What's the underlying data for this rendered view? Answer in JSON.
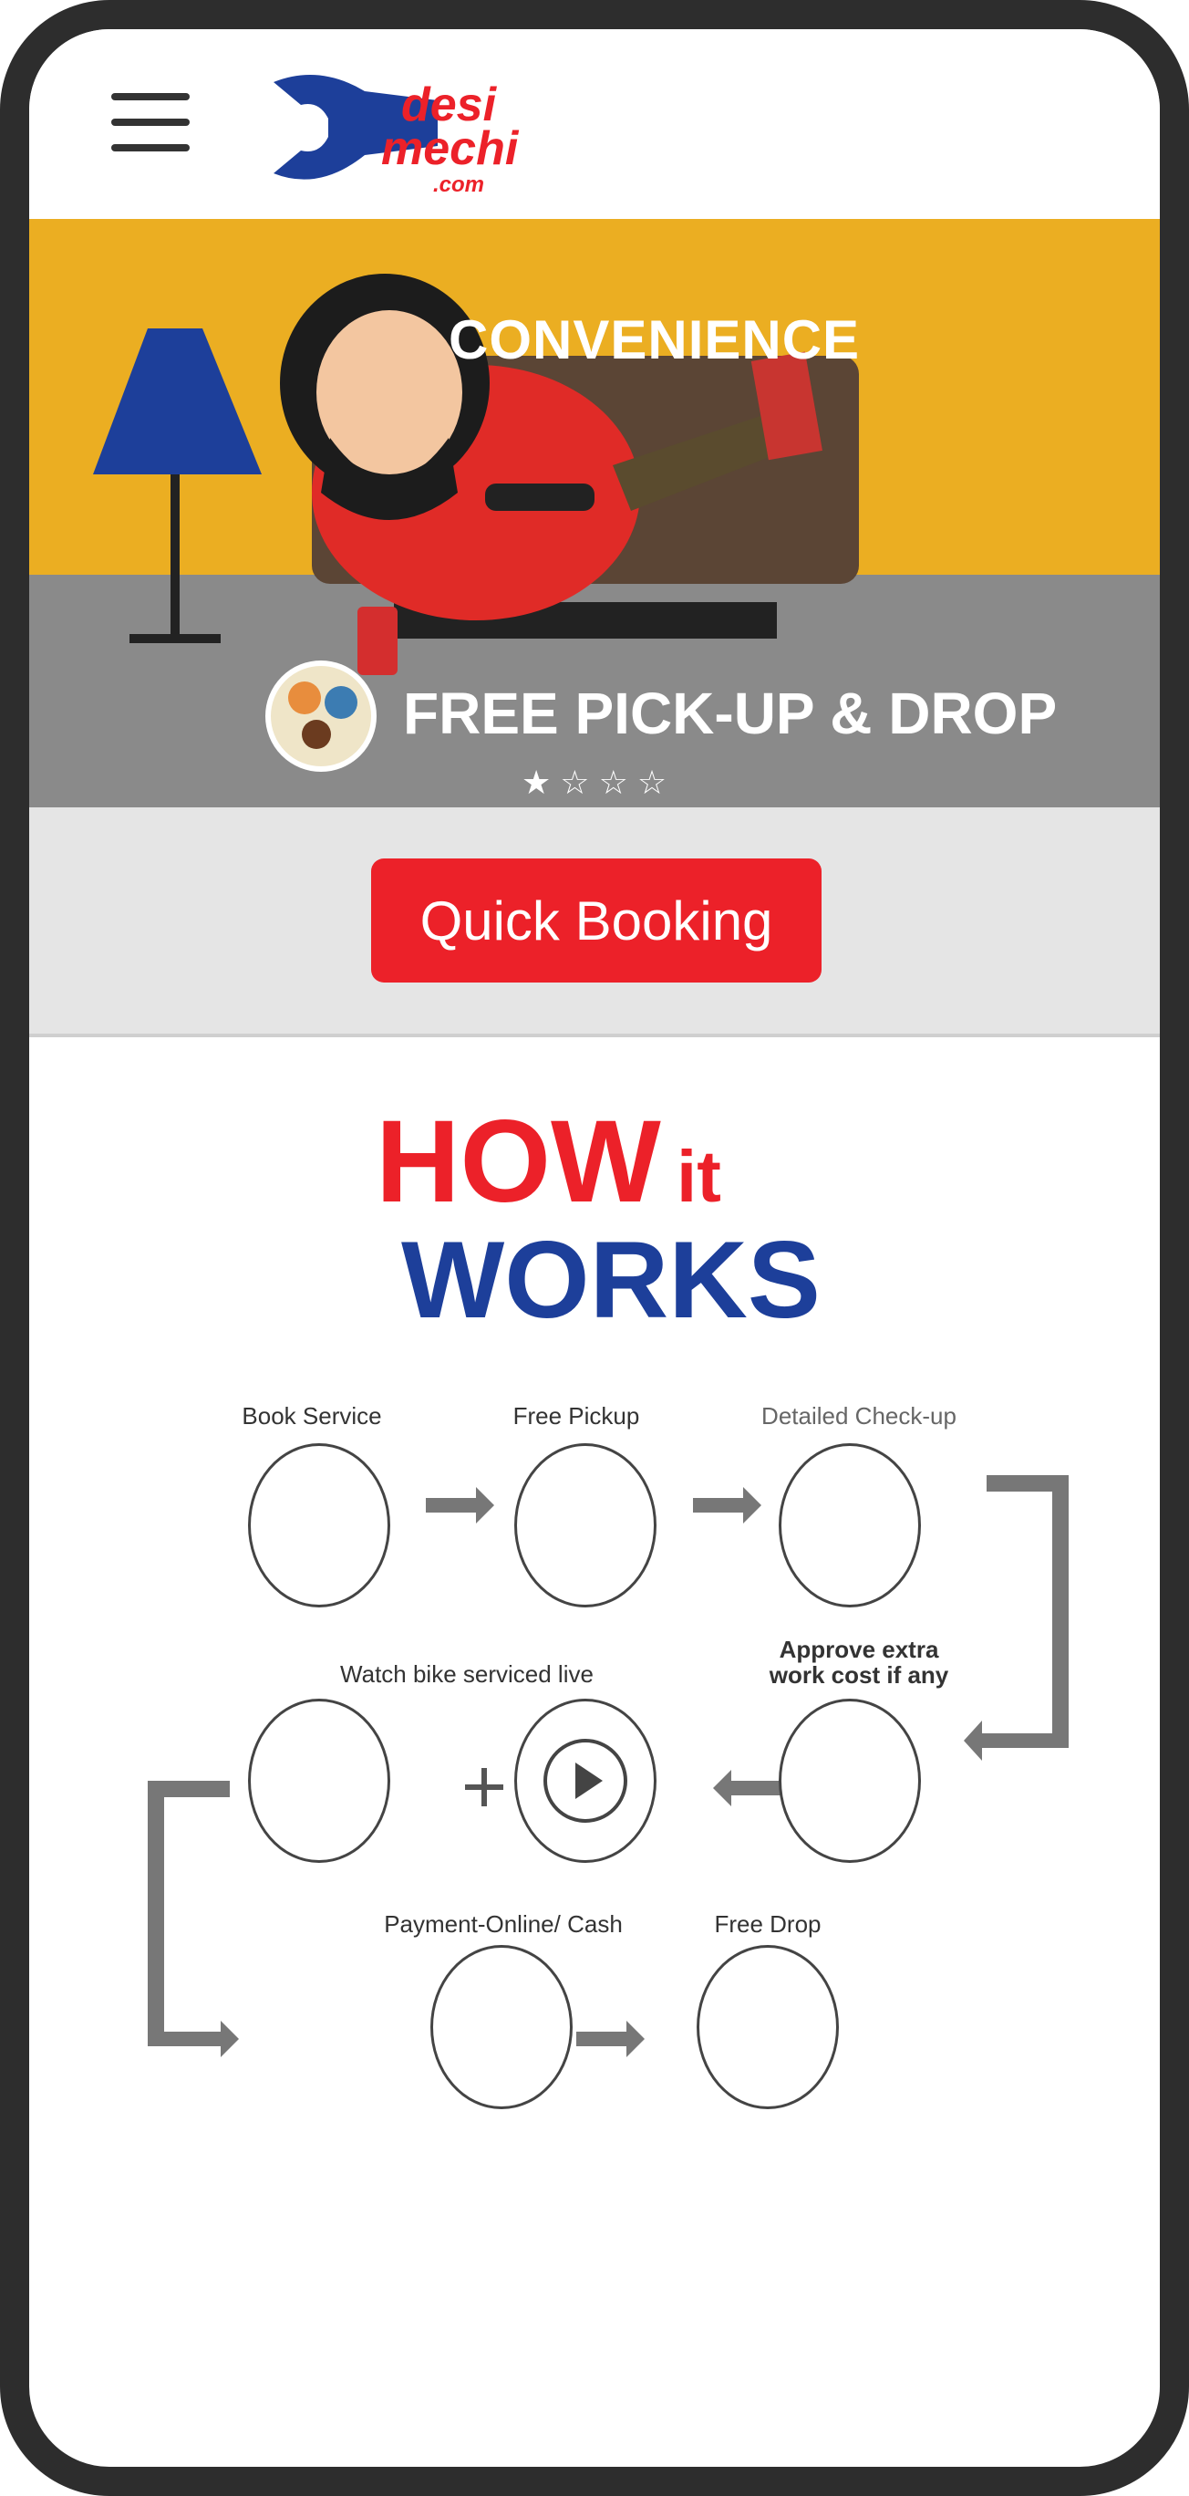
{
  "header": {
    "logo_line1": "desi",
    "logo_line2": "mechi",
    "logo_line3": ".com"
  },
  "banner": {
    "title": "CONVENIENCE",
    "subtitle": "FREE PICK-UP & DROP",
    "dots": [
      "★",
      "☆",
      "☆",
      "☆"
    ]
  },
  "booking": {
    "button_label": "Quick Booking"
  },
  "how_it_works": {
    "heading_how": "HOW",
    "heading_it": "it",
    "heading_works": "WORKS",
    "steps": [
      {
        "label": "Book Service"
      },
      {
        "label": "Free Pickup"
      },
      {
        "label": "Detailed Check-up"
      },
      {
        "label": "Approve extra work cost if any"
      },
      {
        "label": "Watch bike serviced live"
      },
      {
        "label": "Payment-Online/ Cash"
      },
      {
        "label": "Free Drop"
      }
    ]
  },
  "colors": {
    "brand_red": "#ec2129",
    "brand_blue": "#1d3f9a",
    "banner_yellow": "#ebae22",
    "floor_grey": "#8a8a8a"
  }
}
